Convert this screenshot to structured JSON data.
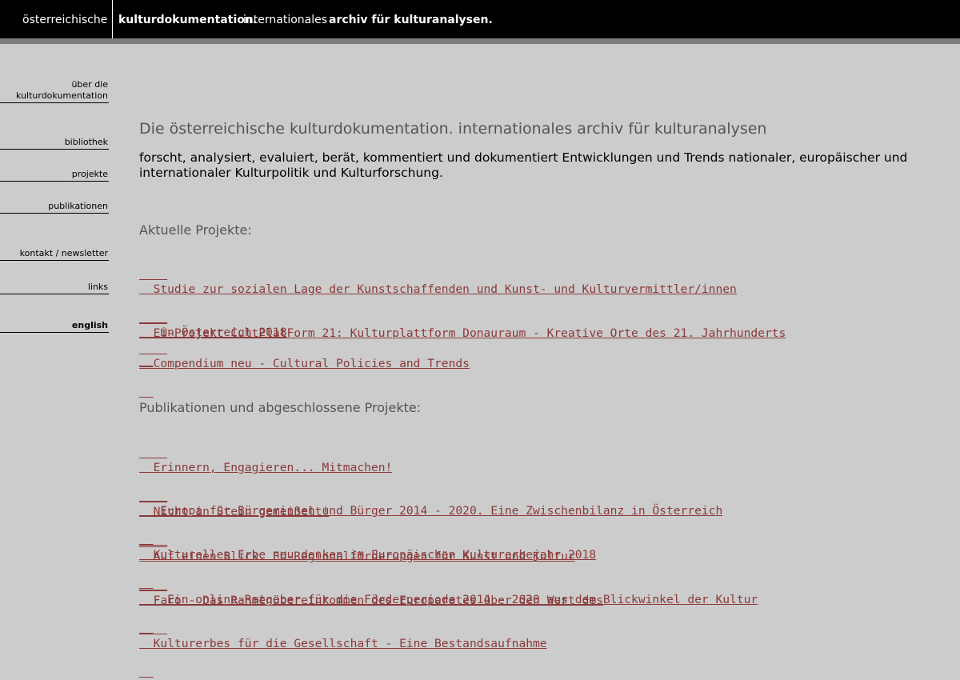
{
  "header": {
    "part1": "österreichische",
    "part2": "kulturdokumentation.",
    "part3": "internationales",
    "part4": "archiv für kulturanalysen."
  },
  "nav": {
    "about_line1": "über die",
    "about_line2": "kulturdokumentation",
    "library": "bibliothek",
    "projects": "projekte",
    "publications": "publikationen",
    "contact": "kontakt / newsletter",
    "links": "links",
    "english": "english"
  },
  "main": {
    "title": "Die österreichische kulturdokumentation. internationales archiv für kulturanalysen",
    "intro": "forscht, analysiert, evaluiert, berät, kommentiert und dokumentiert Entwicklungen und Trends nationaler, europäischer und internationaler Kulturpolitik und Kulturforschung.",
    "current_heading": "Aktuelle Projekte:",
    "current": [
      {
        "line1": "  Studie zur sozialen Lage der Kunstschaffenden und Kunst- und Kulturvermittler/innen",
        "line2": "   in Österreich 2018"
      },
      {
        "line1": "  EU-Projekt CultPlatForm 21: Kulturplattform Donauraum - Kreative Orte des 21. Jahrhunderts"
      },
      {
        "line1": "  Compendium neu - Cultural Policies and Trends"
      }
    ],
    "publications_heading": "Publikationen und abgeschlossene Projekte:",
    "publications": [
      {
        "line1": "  Erinnern, Engagieren... Mitmachen!",
        "line2": "   Europa für Bürgerinnen und Bürger 2014 - 2020. Eine Zwischenbilanz in Österreich"
      },
      {
        "line1": "  Nicht in Stein gemeißelt!",
        "line2": "  Kulturelles Erbe neu denken im Europäischen Kulturerbejahr 2018"
      },
      {
        "line1": "  Auf einen Blick. EU-Regionalförderungen für Kunst und Kultur",
        "line2": "  - Ein online-Ratgeber für die Förderperiode 2014 - 2020 aus dem Blickwinkel der Kultur"
      },
      {
        "line1": "  Faro - Das Rahmenübereinkommen des Europarates über den Wert des",
        "line2": "  Kulturerbes für die Gesellschaft - Eine Bestandsaufnahme"
      }
    ]
  }
}
